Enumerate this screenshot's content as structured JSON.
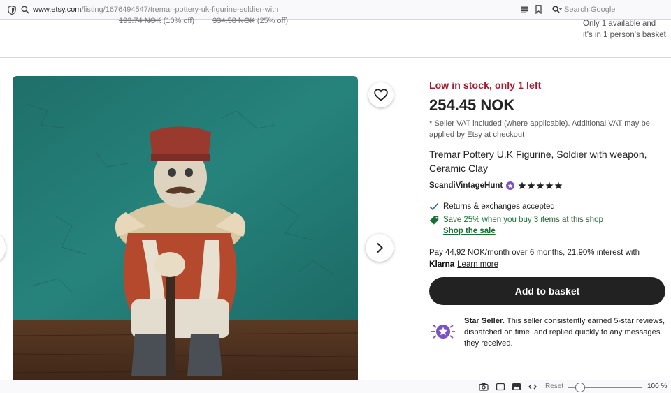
{
  "browser": {
    "url_domain": "www.etsy.com",
    "url_path": "/listing/1676494547/tremar-pottery-uk-figurine-soldier-with",
    "search_placeholder": "Search Google",
    "reset_label": "Reset",
    "zoom_label": "100 %",
    "zoom_level": 1.0
  },
  "top_strip": {
    "price_a": "193.74 NOK",
    "discount_a": "(10% off)",
    "price_b": "334.58 NOK",
    "discount_b": "(25% off)",
    "stock_note": "Only 1 available and it's in 1 person's basket"
  },
  "listing": {
    "low_stock": "Low in stock, only 1 left",
    "price": "254.45 NOK",
    "vat_note": "* Seller VAT included (where applicable). Additional VAT may be applied by Etsy at checkout",
    "title": "Tremar Pottery U.K Figurine, Soldier with weapon, Ceramic Clay",
    "seller": "ScandiVintageHunt",
    "rating": 5,
    "rating_max": 5,
    "returns": "Returns & exchanges accepted",
    "save_offer": "Save 25% when you buy 3 items at this shop",
    "shop_sale": "Shop the sale",
    "klarna_line": "Pay 44,92 NOK/month over 6 months, 21,90% interest with",
    "klarna_logo": "Klarna",
    "learn_more": "Learn more",
    "add_to_basket": "Add to basket",
    "star_seller_title": "Star Seller.",
    "star_seller_body": "This seller consistently earned 5-star reviews, dispatched on time, and replied quickly to any messages they received."
  },
  "colors": {
    "low_stock": "#a61a2e",
    "green": "#1b6f36",
    "button": "#222222",
    "star_badge": "#7b52c4"
  },
  "icons": [
    "shield-icon",
    "search-icon",
    "reader-view-icon",
    "bookmark-icon",
    "heart-icon",
    "chevron-right-icon",
    "chevron-left-icon",
    "check-icon",
    "tag-icon",
    "star-seller-badge-icon",
    "star-icon",
    "screenshot-icon",
    "window-icon",
    "image-icon",
    "code-icon"
  ]
}
